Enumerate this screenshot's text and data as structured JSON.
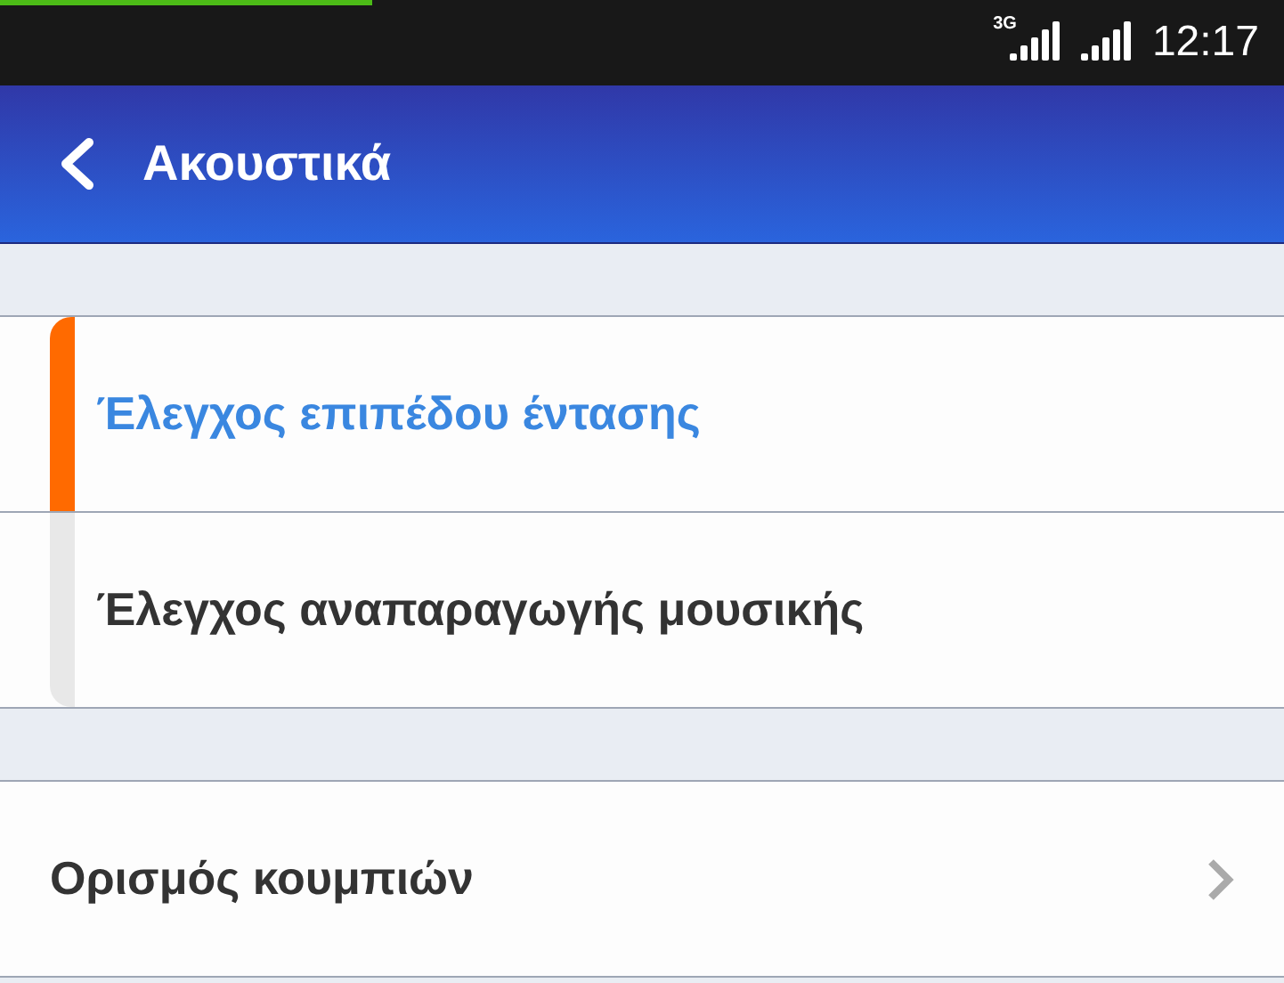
{
  "status_bar": {
    "progress": {
      "level": 0.29
    },
    "network": "3G",
    "time": "12:17"
  },
  "header": {
    "title": "Ακουστικά"
  },
  "control_options": [
    {
      "label": "Έλεγχος επιπέδου έντασης",
      "selected": true
    },
    {
      "label": "Έλεγχος αναπαραγωγής μουσικής",
      "selected": false
    }
  ],
  "settings": [
    {
      "label": "Ορισμός κουμπιών"
    }
  ]
}
